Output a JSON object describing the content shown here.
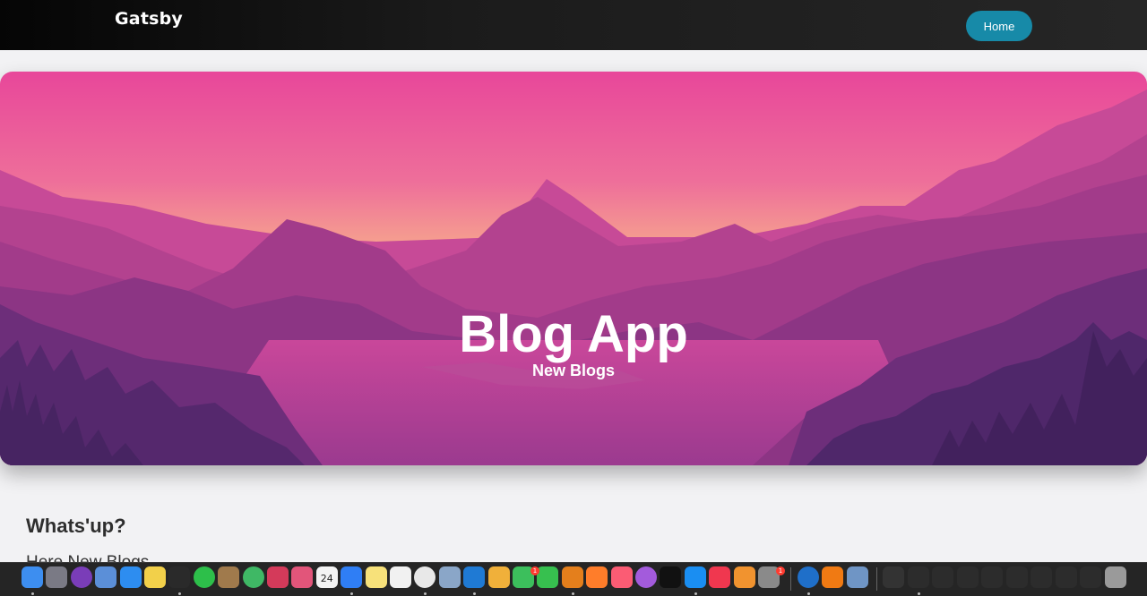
{
  "navbar": {
    "brand": "Gatsby",
    "home_label": "Home"
  },
  "hero": {
    "title": "Blog App",
    "subtitle": "New Blogs"
  },
  "content": {
    "heading": "Whats'up?",
    "text": "Here New Blogs"
  },
  "colors": {
    "accent": "#178aa8",
    "hero_top": "#e8479a",
    "hero_horizon": "#f6a38e",
    "hero_deep": "#4a2a72"
  },
  "dock": {
    "badge_messages": "1",
    "badge_settings": "1",
    "calendar_day": "24",
    "apps": [
      "finder-icon",
      "launchpad-icon",
      "tor-icon",
      "preview-icon",
      "safari-icon",
      "stickies-icon",
      "terminal-icon",
      "activity-icon",
      "archive-icon",
      "maps-icon",
      "photobooth-icon",
      "cleanmymac-icon",
      "calendar-icon",
      "messenger-icon",
      "notes-icon",
      "reminders-icon",
      "chrome-icon",
      "preview2-icon",
      "vscode-icon",
      "photos-icon",
      "messages-icon",
      "facetime-icon",
      "flstudio-icon",
      "avast-icon",
      "music-icon",
      "podcasts-icon",
      "tv-icon",
      "appstore-icon",
      "news-icon",
      "books-icon",
      "settings-icon",
      "edge-icon",
      "vlc-icon",
      "screenshot-icon",
      "window1-icon",
      "window2-icon",
      "window3-icon",
      "window4-icon",
      "window5-icon",
      "window6-icon",
      "window7-icon",
      "window8-icon",
      "window9-icon",
      "trash-icon"
    ]
  }
}
